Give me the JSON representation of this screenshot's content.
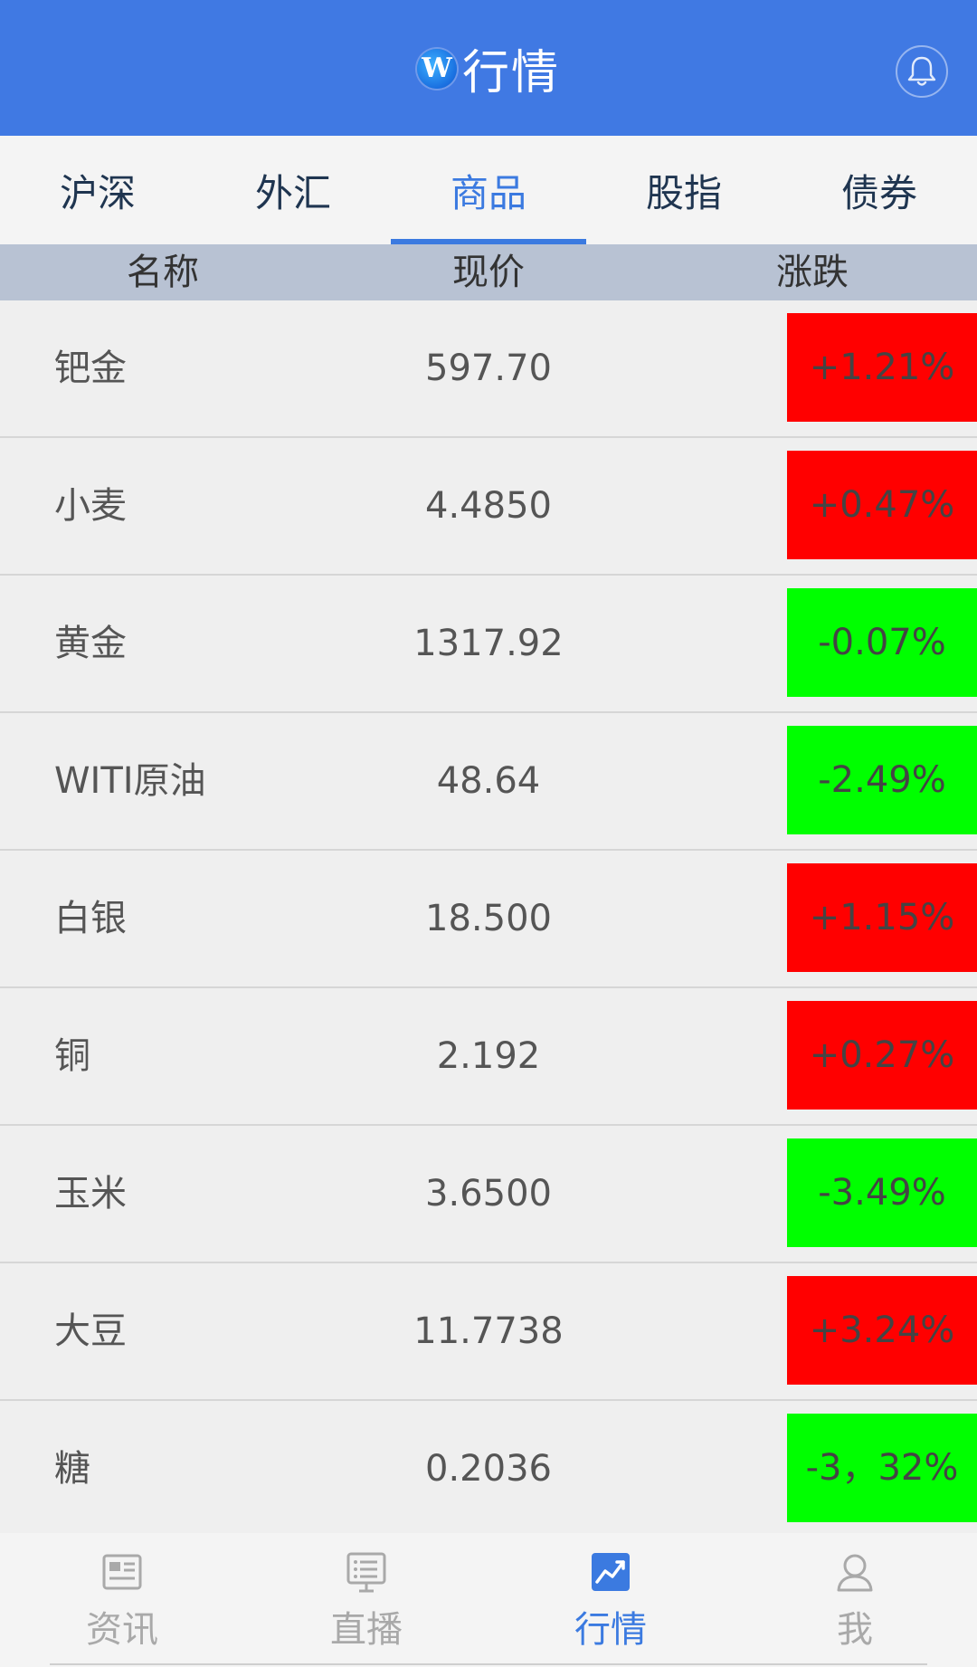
{
  "header": {
    "logo_letter": "W",
    "title": "行情",
    "colors": {
      "background": "#4079e3",
      "text": "#ffffff"
    }
  },
  "tabs": [
    {
      "label": "沪深",
      "active": false
    },
    {
      "label": "外汇",
      "active": false
    },
    {
      "label": "商品",
      "active": true
    },
    {
      "label": "股指",
      "active": false
    },
    {
      "label": "债券",
      "active": false
    }
  ],
  "columns": {
    "name": "名称",
    "price": "现价",
    "change": "涨跌"
  },
  "rows": [
    {
      "name": "钯金",
      "price": "597.70",
      "change": "+1.21%",
      "direction": "up"
    },
    {
      "name": "小麦",
      "price": "4.4850",
      "change": "+0.47%",
      "direction": "up"
    },
    {
      "name": "黄金",
      "price": "1317.92",
      "change": "-0.07%",
      "direction": "down"
    },
    {
      "name": "WITI原油",
      "price": "48.64",
      "change": "-2.49%",
      "direction": "down"
    },
    {
      "name": "白银",
      "price": "18.500",
      "change": "+1.15%",
      "direction": "up"
    },
    {
      "name": "铜",
      "price": "2.192",
      "change": "+0.27%",
      "direction": "up"
    },
    {
      "name": "玉米",
      "price": "3.6500",
      "change": "-3.49%",
      "direction": "down"
    },
    {
      "name": "大豆",
      "price": "11.7738",
      "change": "+3.24%",
      "direction": "up"
    },
    {
      "name": "糖",
      "price": "0.2036",
      "change": "-3，32%",
      "direction": "down"
    }
  ],
  "status_colors": {
    "up": "#ff0000",
    "down": "#00ff00"
  },
  "bottom_nav": [
    {
      "label": "资讯",
      "icon": "news-icon",
      "active": false
    },
    {
      "label": "直播",
      "icon": "live-icon",
      "active": false
    },
    {
      "label": "行情",
      "icon": "market-chart-icon",
      "active": true
    },
    {
      "label": "我",
      "icon": "profile-icon",
      "active": false
    }
  ]
}
